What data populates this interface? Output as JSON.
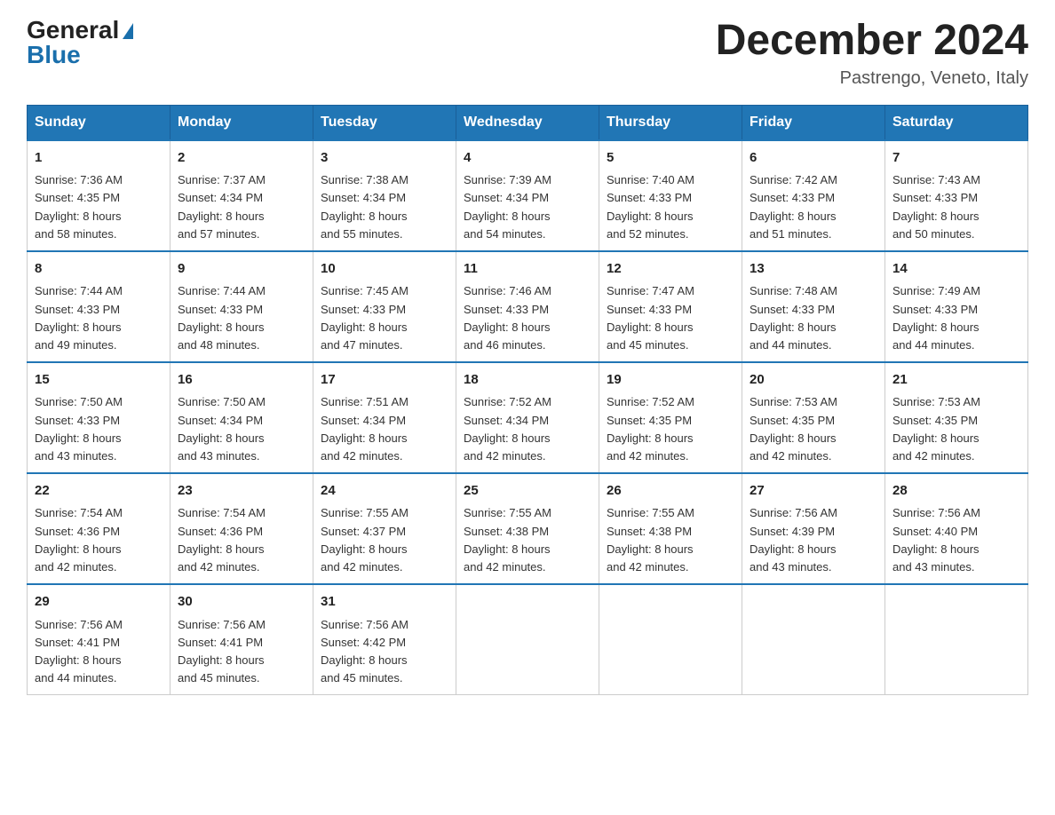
{
  "logo": {
    "general": "General",
    "blue": "Blue",
    "arrow": "▶"
  },
  "title": "December 2024",
  "subtitle": "Pastrengo, Veneto, Italy",
  "days_of_week": [
    "Sunday",
    "Monday",
    "Tuesday",
    "Wednesday",
    "Thursday",
    "Friday",
    "Saturday"
  ],
  "weeks": [
    [
      {
        "day": "1",
        "sunrise": "7:36 AM",
        "sunset": "4:35 PM",
        "daylight": "8 hours and 58 minutes."
      },
      {
        "day": "2",
        "sunrise": "7:37 AM",
        "sunset": "4:34 PM",
        "daylight": "8 hours and 57 minutes."
      },
      {
        "day": "3",
        "sunrise": "7:38 AM",
        "sunset": "4:34 PM",
        "daylight": "8 hours and 55 minutes."
      },
      {
        "day": "4",
        "sunrise": "7:39 AM",
        "sunset": "4:34 PM",
        "daylight": "8 hours and 54 minutes."
      },
      {
        "day": "5",
        "sunrise": "7:40 AM",
        "sunset": "4:33 PM",
        "daylight": "8 hours and 52 minutes."
      },
      {
        "day": "6",
        "sunrise": "7:42 AM",
        "sunset": "4:33 PM",
        "daylight": "8 hours and 51 minutes."
      },
      {
        "day": "7",
        "sunrise": "7:43 AM",
        "sunset": "4:33 PM",
        "daylight": "8 hours and 50 minutes."
      }
    ],
    [
      {
        "day": "8",
        "sunrise": "7:44 AM",
        "sunset": "4:33 PM",
        "daylight": "8 hours and 49 minutes."
      },
      {
        "day": "9",
        "sunrise": "7:44 AM",
        "sunset": "4:33 PM",
        "daylight": "8 hours and 48 minutes."
      },
      {
        "day": "10",
        "sunrise": "7:45 AM",
        "sunset": "4:33 PM",
        "daylight": "8 hours and 47 minutes."
      },
      {
        "day": "11",
        "sunrise": "7:46 AM",
        "sunset": "4:33 PM",
        "daylight": "8 hours and 46 minutes."
      },
      {
        "day": "12",
        "sunrise": "7:47 AM",
        "sunset": "4:33 PM",
        "daylight": "8 hours and 45 minutes."
      },
      {
        "day": "13",
        "sunrise": "7:48 AM",
        "sunset": "4:33 PM",
        "daylight": "8 hours and 44 minutes."
      },
      {
        "day": "14",
        "sunrise": "7:49 AM",
        "sunset": "4:33 PM",
        "daylight": "8 hours and 44 minutes."
      }
    ],
    [
      {
        "day": "15",
        "sunrise": "7:50 AM",
        "sunset": "4:33 PM",
        "daylight": "8 hours and 43 minutes."
      },
      {
        "day": "16",
        "sunrise": "7:50 AM",
        "sunset": "4:34 PM",
        "daylight": "8 hours and 43 minutes."
      },
      {
        "day": "17",
        "sunrise": "7:51 AM",
        "sunset": "4:34 PM",
        "daylight": "8 hours and 42 minutes."
      },
      {
        "day": "18",
        "sunrise": "7:52 AM",
        "sunset": "4:34 PM",
        "daylight": "8 hours and 42 minutes."
      },
      {
        "day": "19",
        "sunrise": "7:52 AM",
        "sunset": "4:35 PM",
        "daylight": "8 hours and 42 minutes."
      },
      {
        "day": "20",
        "sunrise": "7:53 AM",
        "sunset": "4:35 PM",
        "daylight": "8 hours and 42 minutes."
      },
      {
        "day": "21",
        "sunrise": "7:53 AM",
        "sunset": "4:35 PM",
        "daylight": "8 hours and 42 minutes."
      }
    ],
    [
      {
        "day": "22",
        "sunrise": "7:54 AM",
        "sunset": "4:36 PM",
        "daylight": "8 hours and 42 minutes."
      },
      {
        "day": "23",
        "sunrise": "7:54 AM",
        "sunset": "4:36 PM",
        "daylight": "8 hours and 42 minutes."
      },
      {
        "day": "24",
        "sunrise": "7:55 AM",
        "sunset": "4:37 PM",
        "daylight": "8 hours and 42 minutes."
      },
      {
        "day": "25",
        "sunrise": "7:55 AM",
        "sunset": "4:38 PM",
        "daylight": "8 hours and 42 minutes."
      },
      {
        "day": "26",
        "sunrise": "7:55 AM",
        "sunset": "4:38 PM",
        "daylight": "8 hours and 42 minutes."
      },
      {
        "day": "27",
        "sunrise": "7:56 AM",
        "sunset": "4:39 PM",
        "daylight": "8 hours and 43 minutes."
      },
      {
        "day": "28",
        "sunrise": "7:56 AM",
        "sunset": "4:40 PM",
        "daylight": "8 hours and 43 minutes."
      }
    ],
    [
      {
        "day": "29",
        "sunrise": "7:56 AM",
        "sunset": "4:41 PM",
        "daylight": "8 hours and 44 minutes."
      },
      {
        "day": "30",
        "sunrise": "7:56 AM",
        "sunset": "4:41 PM",
        "daylight": "8 hours and 45 minutes."
      },
      {
        "day": "31",
        "sunrise": "7:56 AM",
        "sunset": "4:42 PM",
        "daylight": "8 hours and 45 minutes."
      },
      null,
      null,
      null,
      null
    ]
  ],
  "labels": {
    "sunrise": "Sunrise:",
    "sunset": "Sunset:",
    "daylight": "Daylight:"
  }
}
